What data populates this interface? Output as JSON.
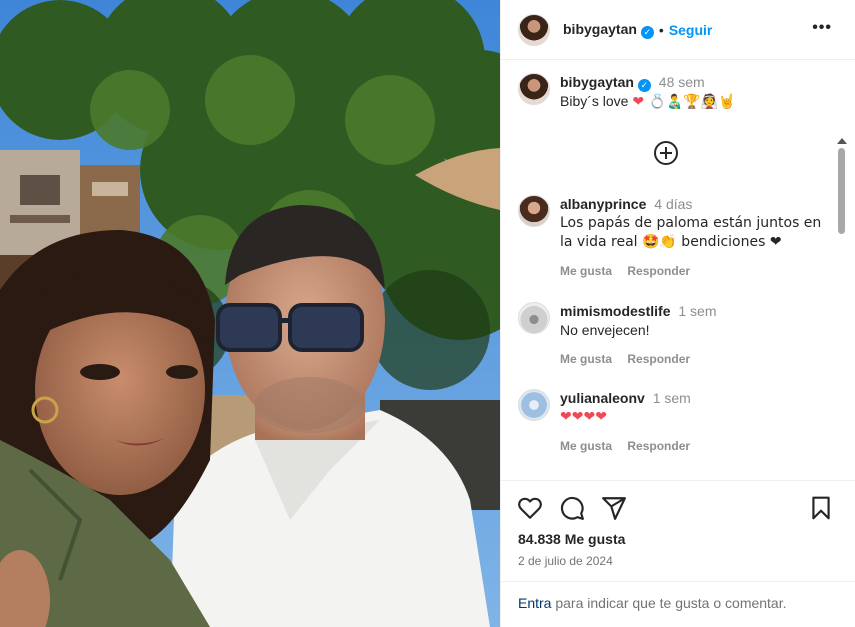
{
  "post": {
    "username": "bibygaytan",
    "follow_label": "Seguir",
    "more_label": "•••",
    "caption_time": "48 sem",
    "caption_text": "Biby´s love",
    "caption_emojis": "❤ 💍👨‍🍼🏆👰🤘"
  },
  "comments": [
    {
      "user": "albanyprince",
      "time": "4 días",
      "text": "Los papás de paloma están juntos en la vida real 🤩👏 bendiciones ❤",
      "like_label": "Me gusta",
      "reply_label": "Responder"
    },
    {
      "user": "mimismodestlife",
      "time": "1 sem",
      "text": "No envejecen!",
      "like_label": "Me gusta",
      "reply_label": "Responder"
    },
    {
      "user": "yulianaleonv",
      "time": "1 sem",
      "text": "❤❤❤❤",
      "like_label": "Me gusta",
      "reply_label": "Responder"
    }
  ],
  "footer": {
    "likes": "84.838 Me gusta",
    "date": "2 de julio de 2024",
    "login_link": "Entra",
    "login_rest": " para indicar que te gusta o comentar."
  },
  "icons": {
    "like": "heart-icon",
    "comment": "speech-bubble-icon",
    "share": "paper-plane-icon",
    "save": "bookmark-icon",
    "add_comments": "plus-circle-icon",
    "verified": "verified-badge-icon",
    "more": "more-options-icon"
  },
  "colors": {
    "accent": "#0095f6",
    "verified": "#0095f6",
    "heart": "#ed4956",
    "muted": "#8e8e8e"
  }
}
